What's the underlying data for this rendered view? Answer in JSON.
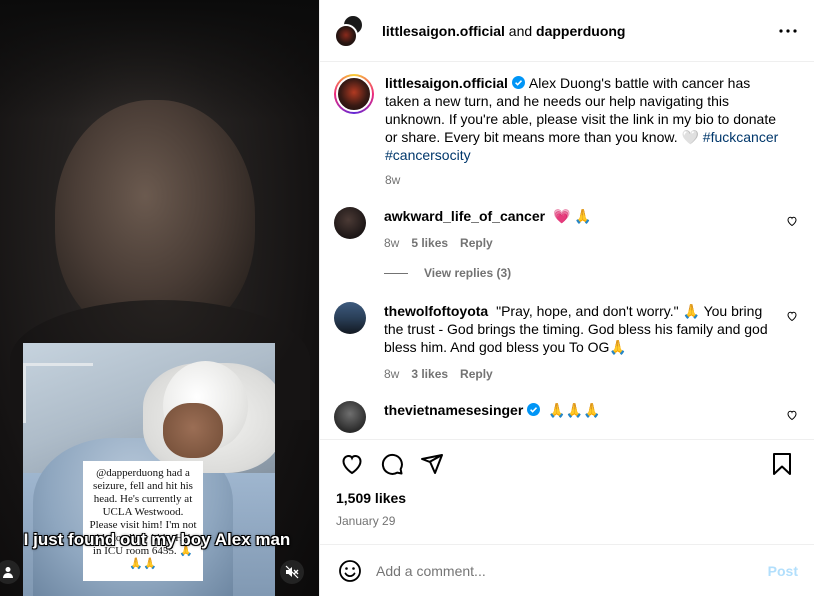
{
  "media": {
    "note_text": "@dapperduong had a seizure, fell and hit his head. He's currently at UCLA Westwood. Please visit him! I'm not able to allow kids. He's in ICU room 6455. 🙏🙏🙏",
    "caption": "I just found out my boy Alex man",
    "user_icon": "person-icon",
    "mute_icon": "speaker-muted-icon"
  },
  "header": {
    "owner": "littlesaigon.official",
    "joiner": "and",
    "collaborator": "dapperduong",
    "more_icon": "more-horizontal-icon"
  },
  "post": {
    "username": "littlesaigon.official",
    "verified": true,
    "caption": "Alex Duong's battle with cancer has taken a new turn, and he needs our help navigating this unknown. If you're able, please visit the link in my bio to donate or share. Every bit means more than you know. 🤍",
    "tags": [
      "#fuckcancer",
      "#cancersocity"
    ],
    "age": "8w"
  },
  "comments": [
    {
      "username": "awkward_life_of_cancer",
      "verified": false,
      "text": "💗 🙏",
      "age": "8w",
      "likes": "5 likes",
      "reply": "Reply",
      "view_replies": "View replies (3)"
    },
    {
      "username": "thewolfoftoyota",
      "verified": false,
      "text": "\"Pray, hope, and don't worry.\" 🙏 You bring the trust - God brings the timing. God bless his family and god bless him. And god bless you To OG🙏",
      "age": "8w",
      "likes": "3 likes",
      "reply": "Reply"
    },
    {
      "username": "thevietnamesesinger",
      "verified": true,
      "text": "🙏🙏🙏"
    }
  ],
  "actions": {
    "like_icon": "heart-icon",
    "comment_icon": "comment-icon",
    "share_icon": "paper-plane-icon",
    "save_icon": "bookmark-icon"
  },
  "likes": "1,509 likes",
  "date": "January 29",
  "add_comment": {
    "placeholder": "Add a comment...",
    "post_label": "Post",
    "emoji_icon": "smiley-icon"
  },
  "colors": {
    "link": "#00376b",
    "secondary": "#737373",
    "post_disabled": "#b2dffc",
    "verified": "#0095f6",
    "heart_emoji": "#e0245e"
  }
}
